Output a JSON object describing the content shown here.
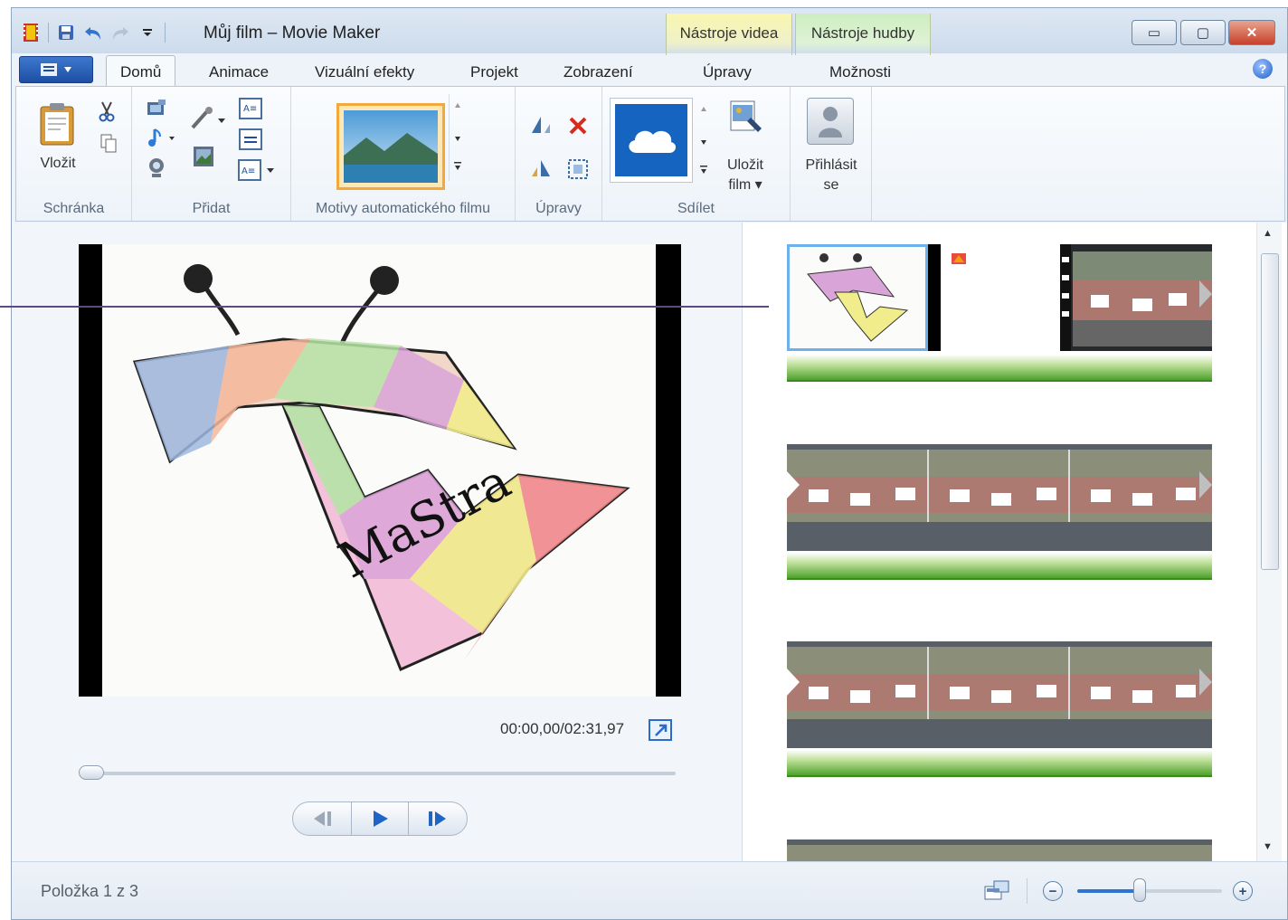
{
  "window": {
    "title": "Můj film – Movie Maker",
    "min_symbol": "▭",
    "max_symbol": "▢",
    "close_symbol": "✕"
  },
  "context_tabs": {
    "video": "Nástroje videa",
    "music": "Nástroje hudby"
  },
  "tabs": {
    "home": "Domů",
    "animations": "Animace",
    "visual_effects": "Vizuální efekty",
    "project": "Projekt",
    "view": "Zobrazení",
    "edit": "Úpravy",
    "options": "Možnosti",
    "help_symbol": "?"
  },
  "ribbon": {
    "clipboard": {
      "paste_label": "Vložit",
      "group_label": "Schránka"
    },
    "add": {
      "group_label": "Přidat"
    },
    "themes": {
      "group_label": "Motivy automatického filmu"
    },
    "editing": {
      "group_label": "Úpravy"
    },
    "share": {
      "group_label": "Sdílet",
      "save_movie_label_1": "Uložit",
      "save_movie_label_2": "film ▾"
    },
    "signin": {
      "label_1": "Přihlásit",
      "label_2": "se"
    }
  },
  "preview": {
    "timecode": "00:00,00/02:31,97",
    "seek_progress": 0,
    "drawing_text": "MaStra"
  },
  "status": {
    "item_text": "Položka 1 z 3",
    "zoom_level": 0.45
  },
  "colors": {
    "accent": "#2a6cc8",
    "audio_green": "#4fa22d",
    "line_purple": "#5d4a80"
  }
}
